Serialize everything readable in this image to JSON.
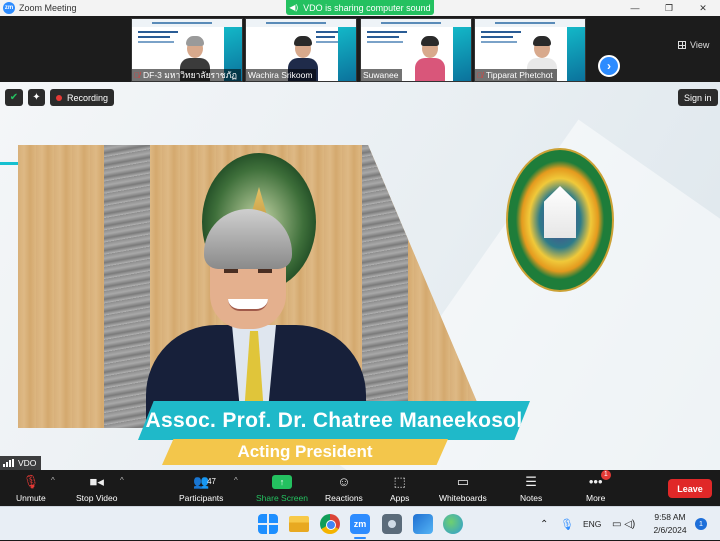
{
  "window": {
    "title": "Zoom Meeting",
    "logo_text": "zm",
    "controls": [
      "—",
      "❐",
      "✕"
    ]
  },
  "share_banner": {
    "text": "VDO is sharing computer sound",
    "icon": "speaker-icon"
  },
  "participants_strip": {
    "thumbnails": [
      {
        "name": "DF-3 มหาวิทยาลัยราชภัฏ",
        "muted": true
      },
      {
        "name": "Wachira Srikoom",
        "muted": false
      },
      {
        "name": "Suwanee",
        "muted": false
      },
      {
        "name": "Tipparat Phetchot",
        "muted": true
      }
    ],
    "next_icon": "chevron-right-icon",
    "view_label": "View"
  },
  "meeting_badges": {
    "recording_label": "Recording",
    "signin_label": "Sign in"
  },
  "presentation": {
    "speaker_name": "Assoc. Prof. Dr. Chatree Maneekosol",
    "speaker_title": "Acting President"
  },
  "active_speaker_label": "VDO",
  "toolbar": {
    "unmute": "Unmute",
    "stop_video": "Stop Video",
    "participants": "Participants",
    "participants_count": "47",
    "share_screen": "Share Screen",
    "reactions": "Reactions",
    "apps": "Apps",
    "whiteboards": "Whiteboards",
    "notes": "Notes",
    "more": "More",
    "more_badge": "1",
    "leave": "Leave"
  },
  "taskbar": {
    "language": "ENG",
    "time": "9:58 AM",
    "date": "2/6/2024",
    "notification_count": "1"
  },
  "colors": {
    "zoom_blue": "#2d8cff",
    "share_green": "#24c160",
    "leave_red": "#e02828",
    "banner_teal": "#1fb9c9",
    "banner_gold": "#f3c64b"
  }
}
